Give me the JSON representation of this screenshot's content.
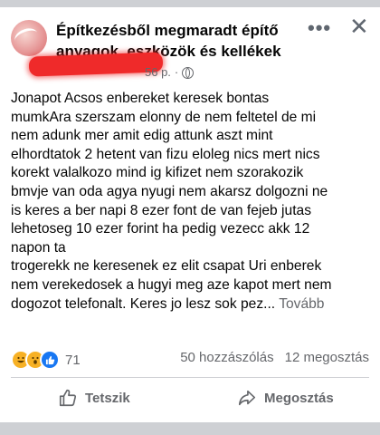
{
  "post": {
    "group_name": "Építkezésből megmaradt építő anyagok, eszközök és kellékek",
    "time": "56 p.",
    "separator": "·",
    "body_lines": [
      "Jonapot Acsos enbereket keresek bontas",
      "mumkAra szerszam elonny de nem feltetel de mi",
      "nem adunk mer amit edig attunk aszt mint",
      "elhordtatok 2 hetent van fizu eloleg nics mert nics",
      "korekt valalkozo mind ig kifizet nem szorakozik",
      "bmvje van oda agya nyugi nem akarsz dolgozni ne",
      "is keres a ber napi 8 ezer font de van fejeb jutas",
      "lehetoseg 10 ezer forint ha pedig vezecc akk 12",
      "napon ta",
      "trogerekk ne keresenek ez elit csapat Uri enberek",
      "nem verekedosek a hugyi meg aze kapot mert nem"
    ],
    "last_line": "dogozot telefonalt. Keres jo lesz sok pez...",
    "see_more": "Tovább"
  },
  "stats": {
    "reaction_icons": [
      "haha",
      "wow",
      "like"
    ],
    "reaction_count": "71",
    "comments": "50 hozzászólás",
    "shares": "12 megosztás"
  },
  "actions": {
    "like_label": "Tetszik",
    "share_label": "Megosztás"
  },
  "header": {
    "more_glyph": "•••",
    "close_glyph": "✕"
  }
}
